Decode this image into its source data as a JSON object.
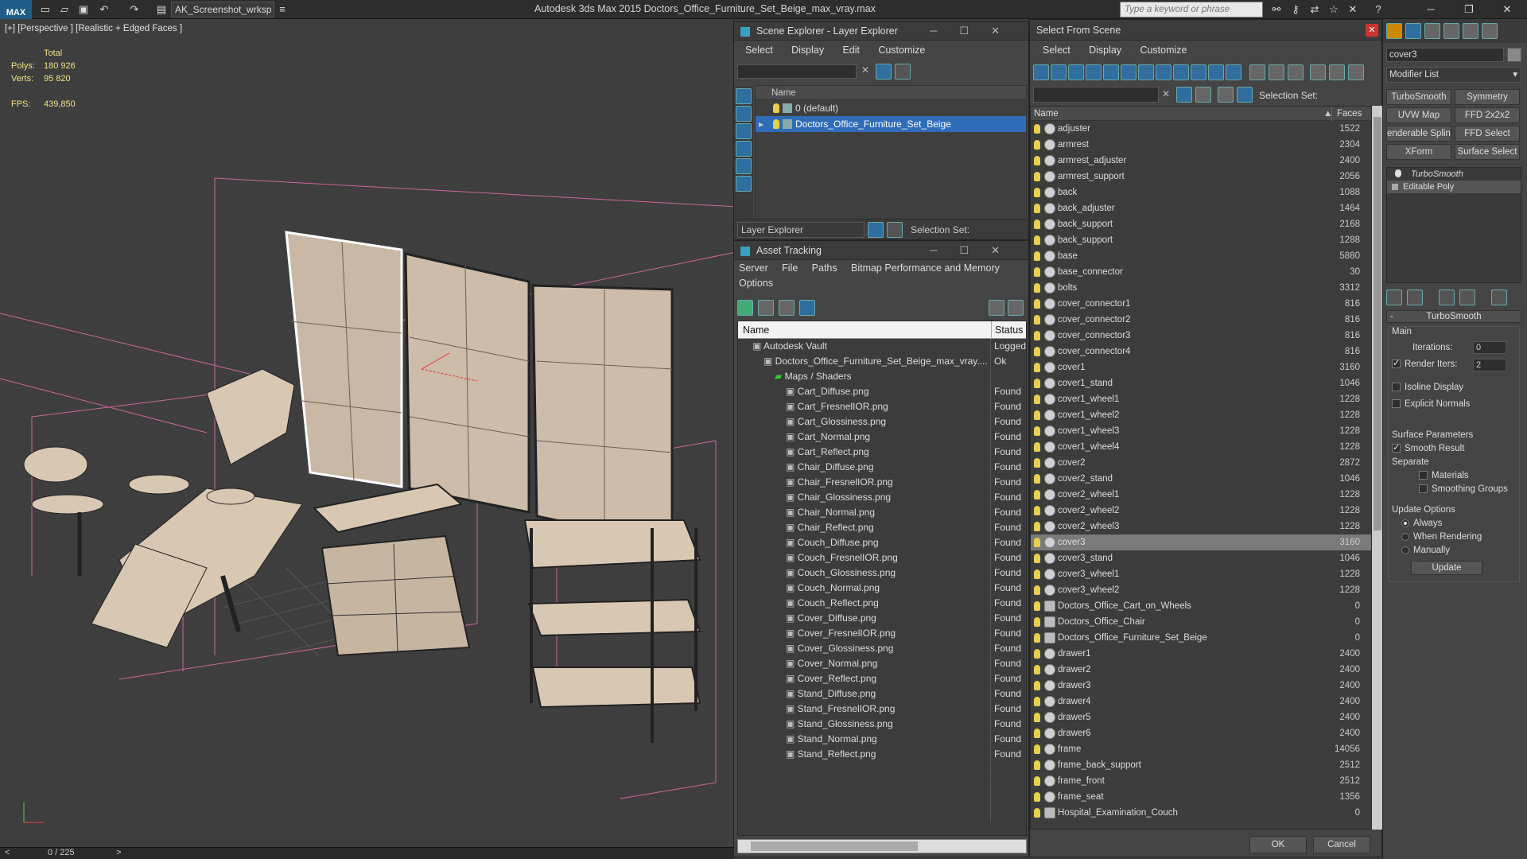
{
  "titlebar": {
    "logo": "MAX",
    "workspace": "AK_Screenshot_wrksp",
    "app_title": "Autodesk 3ds Max  2015     Doctors_Office_Furniture_Set_Beige_max_vray.max",
    "search_placeholder": "Type a keyword or phrase"
  },
  "viewport": {
    "label": "[+] [Perspective ] [Realistic + Edged Faces ]",
    "stats_total": "Total",
    "polys_label": "Polys:",
    "polys_value": "180 926",
    "verts_label": "Verts:",
    "verts_value": "95 820",
    "fps_label": "FPS:",
    "fps_value": "439,850"
  },
  "timeline": {
    "frame": "0 / 225",
    "prev": "<",
    "next": ">"
  },
  "scene_explorer": {
    "title": "Scene Explorer - Layer Explorer",
    "menu": [
      "Select",
      "Display",
      "Edit",
      "Customize"
    ],
    "col_name": "Name",
    "layers": [
      "0 (default)",
      "Doctors_Office_Furniture_Set_Beige"
    ],
    "footer_label": "Layer Explorer",
    "selection_set": "Selection Set:"
  },
  "asset_tracking": {
    "title": "Asset Tracking",
    "menu": [
      "Server",
      "File",
      "Paths",
      "Bitmap Performance and Memory"
    ],
    "menu2": "Options",
    "col_name": "Name",
    "col_status": "Status",
    "rows": [
      {
        "name": "Autodesk Vault",
        "status": "Logged",
        "indent": 1
      },
      {
        "name": "Doctors_Office_Furniture_Set_Beige_max_vray....",
        "status": "Ok",
        "indent": 2
      },
      {
        "name": "Maps / Shaders",
        "status": "",
        "indent": 3
      },
      {
        "name": "Cart_Diffuse.png",
        "status": "Found",
        "indent": 4
      },
      {
        "name": "Cart_FresnelIOR.png",
        "status": "Found",
        "indent": 4
      },
      {
        "name": "Cart_Glossiness.png",
        "status": "Found",
        "indent": 4
      },
      {
        "name": "Cart_Normal.png",
        "status": "Found",
        "indent": 4
      },
      {
        "name": "Cart_Reflect.png",
        "status": "Found",
        "indent": 4
      },
      {
        "name": "Chair_Diffuse.png",
        "status": "Found",
        "indent": 4
      },
      {
        "name": "Chair_FresnelIOR.png",
        "status": "Found",
        "indent": 4
      },
      {
        "name": "Chair_Glossiness.png",
        "status": "Found",
        "indent": 4
      },
      {
        "name": "Chair_Normal.png",
        "status": "Found",
        "indent": 4
      },
      {
        "name": "Chair_Reflect.png",
        "status": "Found",
        "indent": 4
      },
      {
        "name": "Couch_Diffuse.png",
        "status": "Found",
        "indent": 4
      },
      {
        "name": "Couch_FresnelIOR.png",
        "status": "Found",
        "indent": 4
      },
      {
        "name": "Couch_Glossiness.png",
        "status": "Found",
        "indent": 4
      },
      {
        "name": "Couch_Normal.png",
        "status": "Found",
        "indent": 4
      },
      {
        "name": "Couch_Reflect.png",
        "status": "Found",
        "indent": 4
      },
      {
        "name": "Cover_Diffuse.png",
        "status": "Found",
        "indent": 4
      },
      {
        "name": "Cover_FresnelIOR.png",
        "status": "Found",
        "indent": 4
      },
      {
        "name": "Cover_Glossiness.png",
        "status": "Found",
        "indent": 4
      },
      {
        "name": "Cover_Normal.png",
        "status": "Found",
        "indent": 4
      },
      {
        "name": "Cover_Reflect.png",
        "status": "Found",
        "indent": 4
      },
      {
        "name": "Stand_Diffuse.png",
        "status": "Found",
        "indent": 4
      },
      {
        "name": "Stand_FresnelIOR.png",
        "status": "Found",
        "indent": 4
      },
      {
        "name": "Stand_Glossiness.png",
        "status": "Found",
        "indent": 4
      },
      {
        "name": "Stand_Normal.png",
        "status": "Found",
        "indent": 4
      },
      {
        "name": "Stand_Reflect.png",
        "status": "Found",
        "indent": 4
      }
    ]
  },
  "select_from_scene": {
    "title": "Select From Scene",
    "menu": [
      "Select",
      "Display",
      "Customize"
    ],
    "selection_set": "Selection Set:",
    "col_name": "Name",
    "col_faces": "Faces",
    "ok": "OK",
    "cancel": "Cancel",
    "rows": [
      {
        "name": "adjuster",
        "faces": "1522"
      },
      {
        "name": "armrest",
        "faces": "2304"
      },
      {
        "name": "armrest_adjuster",
        "faces": "2400"
      },
      {
        "name": "armrest_support",
        "faces": "2056"
      },
      {
        "name": "back",
        "faces": "1088"
      },
      {
        "name": "back_adjuster",
        "faces": "1464"
      },
      {
        "name": "back_support",
        "faces": "2168"
      },
      {
        "name": "back_support",
        "faces": "1288"
      },
      {
        "name": "base",
        "faces": "5880"
      },
      {
        "name": "base_connector",
        "faces": "30"
      },
      {
        "name": "bolts",
        "faces": "3312"
      },
      {
        "name": "cover_connector1",
        "faces": "816"
      },
      {
        "name": "cover_connector2",
        "faces": "816"
      },
      {
        "name": "cover_connector3",
        "faces": "816"
      },
      {
        "name": "cover_connector4",
        "faces": "816"
      },
      {
        "name": "cover1",
        "faces": "3160"
      },
      {
        "name": "cover1_stand",
        "faces": "1046"
      },
      {
        "name": "cover1_wheel1",
        "faces": "1228"
      },
      {
        "name": "cover1_wheel2",
        "faces": "1228"
      },
      {
        "name": "cover1_wheel3",
        "faces": "1228"
      },
      {
        "name": "cover1_wheel4",
        "faces": "1228"
      },
      {
        "name": "cover2",
        "faces": "2872"
      },
      {
        "name": "cover2_stand",
        "faces": "1046"
      },
      {
        "name": "cover2_wheel1",
        "faces": "1228"
      },
      {
        "name": "cover2_wheel2",
        "faces": "1228"
      },
      {
        "name": "cover2_wheel3",
        "faces": "1228"
      },
      {
        "name": "cover3",
        "faces": "3160"
      },
      {
        "name": "cover3_stand",
        "faces": "1046"
      },
      {
        "name": "cover3_wheel1",
        "faces": "1228"
      },
      {
        "name": "cover3_wheel2",
        "faces": "1228"
      },
      {
        "name": "Doctors_Office_Cart_on_Wheels",
        "faces": "0"
      },
      {
        "name": "Doctors_Office_Chair",
        "faces": "0"
      },
      {
        "name": "Doctors_Office_Furniture_Set_Beige",
        "faces": "0"
      },
      {
        "name": "drawer1",
        "faces": "2400"
      },
      {
        "name": "drawer2",
        "faces": "2400"
      },
      {
        "name": "drawer3",
        "faces": "2400"
      },
      {
        "name": "drawer4",
        "faces": "2400"
      },
      {
        "name": "drawer5",
        "faces": "2400"
      },
      {
        "name": "drawer6",
        "faces": "2400"
      },
      {
        "name": "frame",
        "faces": "14056"
      },
      {
        "name": "frame_back_support",
        "faces": "2512"
      },
      {
        "name": "frame_front",
        "faces": "2512"
      },
      {
        "name": "frame_seat",
        "faces": "1356"
      },
      {
        "name": "Hospital_Examination_Couch",
        "faces": "0"
      }
    ],
    "selected": "cover3"
  },
  "modify_panel": {
    "object_name": "cover3",
    "modifier_list": "Modifier List",
    "buttons": [
      "TurboSmooth",
      "Symmetry",
      "UVW Map",
      "FFD 2x2x2",
      "enderable Splin",
      "FFD Select",
      "XForm",
      "Surface Select"
    ],
    "stack": [
      "TurboSmooth",
      "Editable Poly"
    ],
    "rollout_title": "TurboSmooth",
    "main": "Main",
    "iterations_label": "Iterations:",
    "iterations": "0",
    "render_iters_label": "Render Iters:",
    "render_iters": "2",
    "isoline": "Isoline Display",
    "explicit": "Explicit Normals",
    "surface_params": "Surface Parameters",
    "smooth_result": "Smooth Result",
    "separate": "Separate",
    "materials": "Materials",
    "smoothing_groups": "Smoothing Groups",
    "update_options": "Update Options",
    "always": "Always",
    "when_rendering": "When Rendering",
    "manually": "Manually",
    "update": "Update"
  }
}
